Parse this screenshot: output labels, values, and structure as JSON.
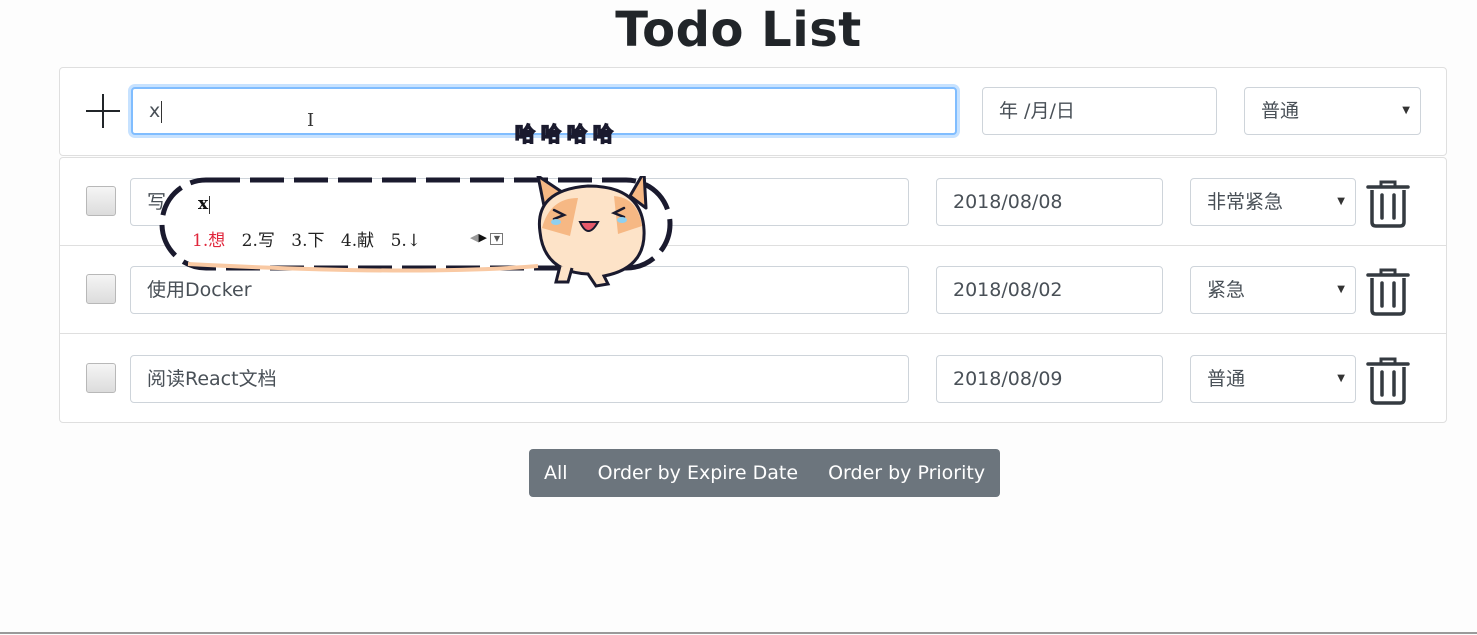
{
  "app": {
    "title": "Todo List"
  },
  "new_todo": {
    "input_value": "x",
    "date_placeholder": "年 /月/日",
    "priority": "普通"
  },
  "todos": [
    {
      "text": "写",
      "date": "2018/08/08",
      "priority": "非常紧急"
    },
    {
      "text": "使用Docker",
      "date": "2018/08/02",
      "priority": "紧急"
    },
    {
      "text": "阅读React文档",
      "date": "2018/08/09",
      "priority": "普通"
    }
  ],
  "filters": {
    "all": "All",
    "by_date": "Order by Expire Date",
    "by_priority": "Order by Priority"
  },
  "ime": {
    "composition": "x",
    "candidates": [
      "1.想",
      "2.写",
      "3.下",
      "4.献",
      "5.↓"
    ],
    "mascot_text": "哈哈哈哈"
  },
  "colors": {
    "focus_ring": "#80bdff",
    "button_group": "#6c757d",
    "ime_selected": "#e0263b"
  },
  "icons": {
    "add": "plus-icon",
    "delete": "trash-icon",
    "dropdown": "caret-down-icon"
  }
}
